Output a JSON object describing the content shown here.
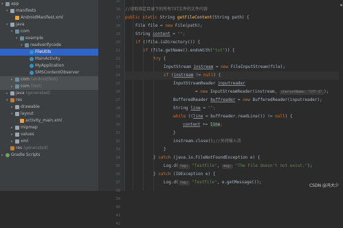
{
  "project_tree": {
    "items": [
      {
        "label": "app",
        "depth": 0,
        "arrow": "▾",
        "icon": "module",
        "tag": ""
      },
      {
        "label": "manifests",
        "depth": 1,
        "arrow": "▾",
        "icon": "folder",
        "tag": ""
      },
      {
        "label": "AndroidManifest.xml",
        "depth": 2,
        "arrow": "",
        "icon": "xml",
        "tag": ""
      },
      {
        "label": "java",
        "depth": 1,
        "arrow": "▾",
        "icon": "folder",
        "tag": ""
      },
      {
        "label": "com",
        "depth": 2,
        "arrow": "▾",
        "icon": "pkg",
        "tag": ""
      },
      {
        "label": "example",
        "depth": 3,
        "arrow": "▾",
        "icon": "pkg",
        "tag": ""
      },
      {
        "label": "readverifycode",
        "depth": 4,
        "arrow": "▾",
        "icon": "pkg",
        "tag": ""
      },
      {
        "label": "FileUtils",
        "depth": 5,
        "arrow": "",
        "icon": "cls",
        "tag": "",
        "selected": true
      },
      {
        "label": "MainActivity",
        "depth": 5,
        "arrow": "",
        "icon": "cls",
        "tag": ""
      },
      {
        "label": "MyApplication",
        "depth": 5,
        "arrow": "",
        "icon": "cls",
        "tag": ""
      },
      {
        "label": "SMSContentObserver",
        "depth": 5,
        "arrow": "",
        "icon": "cls",
        "tag": ""
      },
      {
        "label": "com",
        "depth": 2,
        "arrow": "▸",
        "icon": "pkg",
        "tag": "(androidTest)",
        "hl": true
      },
      {
        "label": "com",
        "depth": 2,
        "arrow": "▸",
        "icon": "pkg",
        "tag": "(test)",
        "hl": true
      },
      {
        "label": "java",
        "depth": 1,
        "arrow": "▸",
        "icon": "folder",
        "tag": "(generated)"
      },
      {
        "label": "res",
        "depth": 1,
        "arrow": "▾",
        "icon": "res",
        "tag": ""
      },
      {
        "label": "drawable",
        "depth": 2,
        "arrow": "▸",
        "icon": "folder",
        "tag": ""
      },
      {
        "label": "layout",
        "depth": 2,
        "arrow": "▾",
        "icon": "folder",
        "tag": ""
      },
      {
        "label": "activity_main.xml",
        "depth": 3,
        "arrow": "",
        "icon": "xml",
        "tag": ""
      },
      {
        "label": "mipmap",
        "depth": 2,
        "arrow": "▸",
        "icon": "folder",
        "tag": ""
      },
      {
        "label": "values",
        "depth": 2,
        "arrow": "▸",
        "icon": "folder",
        "tag": ""
      },
      {
        "label": "xml",
        "depth": 2,
        "arrow": "▸",
        "icon": "folder",
        "tag": ""
      },
      {
        "label": "res",
        "depth": 1,
        "arrow": "",
        "icon": "res",
        "tag": "(generated)"
      },
      {
        "label": "Gradle Scripts",
        "depth": 0,
        "arrow": "▸",
        "icon": "gradle",
        "tag": ""
      }
    ]
  },
  "gutter": {
    "line_numbers": [
      "15",
      "16",
      "17",
      "18",
      "19",
      "20",
      "21",
      "22",
      "23",
      "24",
      "25",
      "26",
      "27",
      "28",
      "29",
      "30",
      "31",
      "32",
      "33",
      "34",
      "35",
      "36",
      "37",
      "38",
      "39",
      "40",
      "41",
      "42"
    ]
  },
  "code": {
    "l1_comment": "//读取指定目录下的所有TXT文件的文件内容",
    "l2": {
      "kw": "public static ",
      "type": "String ",
      "method": "getFileContent",
      "rest": "(String path) {"
    },
    "l3": {
      "pre": "File file = ",
      "kw": "new ",
      "rest": "File(path);"
    },
    "l4": {
      "pre": "String ",
      "var": "content",
      "mid": " = ",
      "str": "\"\"",
      "end": ";"
    },
    "l5": {
      "kw": "if ",
      "rest": "(!file.isDirectory()) {"
    },
    "l6": {
      "kw": "if ",
      "pre": "(file.getName().endsWith(",
      "str": "\"txt\"",
      "end": ")) {"
    },
    "l7": {
      "kw": "try ",
      "end": "{"
    },
    "l8": {
      "pre": "InputStream ",
      "var": "instream",
      "mid": " = ",
      "kw": "new ",
      "rest": "FileInputStream(file);"
    },
    "l9": {
      "kw": "if ",
      "p1": "(",
      "var": "instream",
      "mid": " != ",
      "kw2": "null",
      "end": ") {"
    },
    "l10": {
      "pre": "InputStreamReader ",
      "var": "inputreader"
    },
    "l11": {
      "pre": "= ",
      "kw": "new ",
      "rest": "InputStreamReader(instream, ",
      "hint_name": "charsetName:",
      "hint_val": "\"UTF-8\"",
      "end": ");"
    },
    "l12": {
      "pre": "BufferedReader ",
      "var": "buffreader",
      "mid": " = ",
      "kw": "new ",
      "rest": "BufferedReader(inputreader);"
    },
    "l13": {
      "pre": "String ",
      "var": "line",
      "mid": " = ",
      "str": "\"\"",
      "end": ";"
    },
    "l14": {
      "kw": "while ",
      "p1": "((",
      "var": "line",
      "mid": " = buffreader.readLine()) != ",
      "kw2": "null",
      "end": ") {"
    },
    "l15": {
      "var": "content",
      "mid": " += ",
      "var2": "line",
      "end": ";"
    },
    "l16": "}",
    "l17": {
      "pre": "instream.close();",
      "comment": "//关闭输入流"
    },
    "l18": "}",
    "l19": {
      "pre": "} ",
      "kw": "catch ",
      "rest": "(java.io.FileNotFoundException e) {"
    },
    "l20": {
      "pre": "Log.d(",
      "hint_tag": "tag:",
      "str1": "\"TestFile\"",
      "sep": ", ",
      "hint_msg": "msg:",
      "str2": "\"The File doesn't not exist.\"",
      "end": ");"
    },
    "l21": {
      "pre": "} ",
      "kw": "catch ",
      "rest": "(IOException e) {"
    },
    "l22": {
      "pre": "Log.d(",
      "hint_tag": "tag:",
      "str1": "\"TestFile\"",
      "end": ", e.getMessage());"
    },
    "l23": "}",
    "l24": "}",
    "l25": "}",
    "l26": {
      "kw": "return ",
      "var": "content",
      "end": ";"
    },
    "l27": "}"
  },
  "watermark": "CSDN @冯大少",
  "colors": {
    "background": "#2b2b2b",
    "keyword": "#cc7832",
    "string": "#6a8759",
    "comment": "#808080",
    "method": "#ffc66d",
    "selection": "#2f65ca"
  }
}
